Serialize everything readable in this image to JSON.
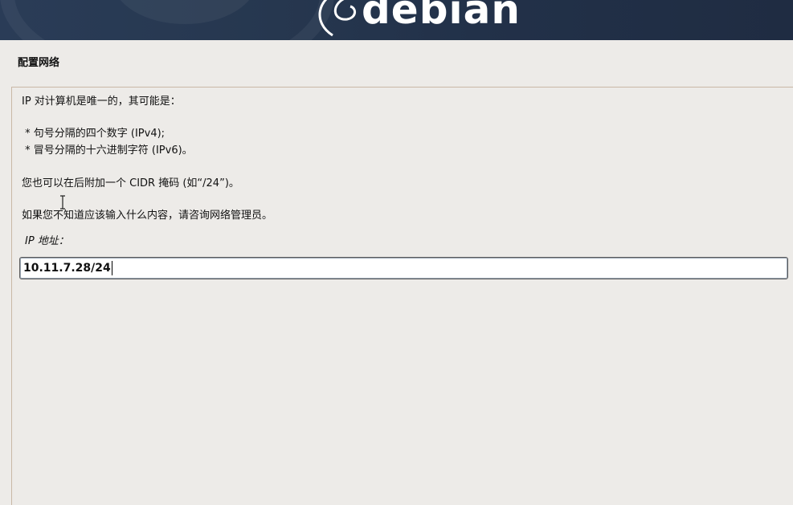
{
  "banner": {
    "logo_text": "debian",
    "background_color": "#26374f",
    "logo_icon": "debian-swirl-icon"
  },
  "page_title": "配置网络",
  "description": {
    "line1": "IP 对计算机是唯一的，其可能是：",
    "bullet1": " * 句号分隔的四个数字 (IPv4);",
    "bullet2": " * 冒号分隔的十六进制字符 (IPv6)。",
    "line2": "您也可以在后附加一个 CIDR 掩码 (如“/24”)。",
    "line3": "如果您不知道应该输入什么内容，请咨询网络管理员。"
  },
  "ip_field": {
    "label": "IP 地址：",
    "value": "10.11.7.28/24"
  },
  "cursor_icon": "text-cursor-icon"
}
